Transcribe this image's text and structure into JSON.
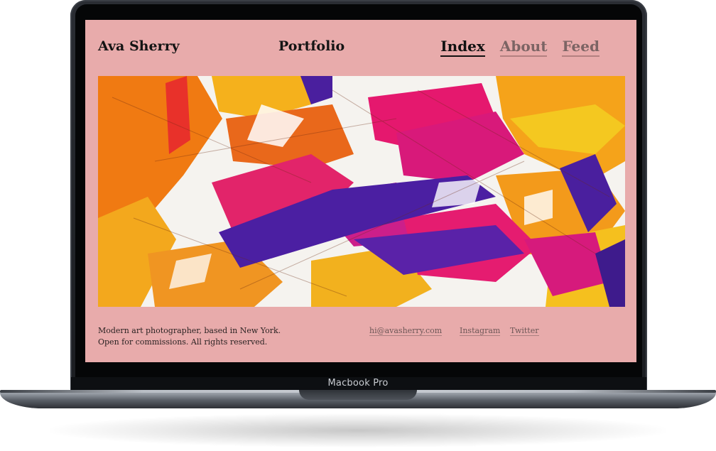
{
  "device": {
    "label": "Macbook Pro"
  },
  "site": {
    "name": "Ava Sherry",
    "section_title": "Portfolio",
    "nav": [
      {
        "label": "Index",
        "active": true
      },
      {
        "label": "About",
        "active": false
      },
      {
        "label": "Feed",
        "active": false
      }
    ]
  },
  "hero_image": {
    "description": "abstract-painting",
    "colors": [
      "#f28a1a",
      "#e5186e",
      "#4a1f9e",
      "#f5c520",
      "#ffffff"
    ]
  },
  "footer": {
    "bio": "Modern art photographer, based in New York. Open for commissions. All rights reserved.",
    "email": "hi@avasherry.com",
    "social": [
      "Instagram",
      "Twitter"
    ]
  },
  "colors": {
    "page_background": "#e8abab",
    "text": "#141414"
  }
}
